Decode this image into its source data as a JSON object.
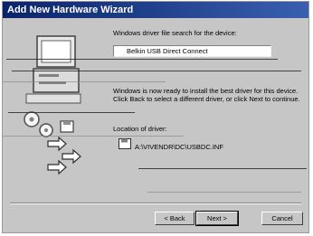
{
  "window": {
    "title": "Add New Hardware Wizard"
  },
  "wizard": {
    "heading": "Windows driver file search for the device:",
    "device_name": "Belkin USB Direct Connect",
    "message": "Windows is now ready to install the best driver for this device. Click Back to select a different driver, or click Next to continue.",
    "location_label": "Location of driver:",
    "driver_path": "A:\\VIVENDR\\DC\\USBDC.INF"
  },
  "buttons": {
    "back_label": "< Back",
    "next_label": "Next >",
    "cancel_label": "Cancel"
  },
  "colors": {
    "titlebar": "#0a246a",
    "dialog": "#c6c6c6"
  },
  "icons": [
    "computer-icon",
    "disk-icon",
    "arrow-icon",
    "floppy-icon"
  ]
}
